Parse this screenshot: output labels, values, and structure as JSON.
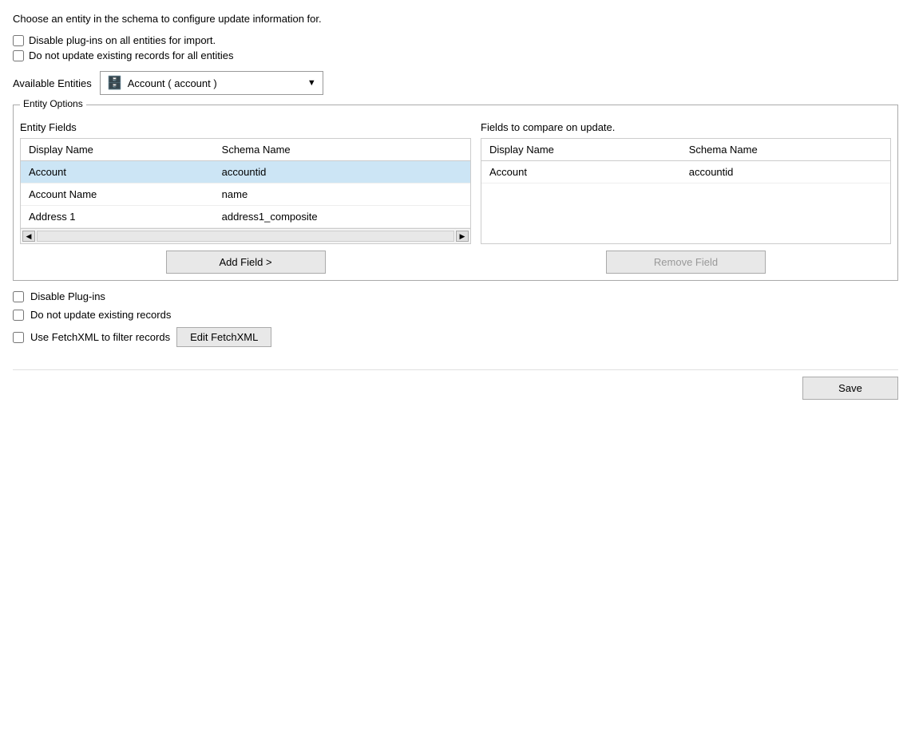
{
  "intro": {
    "text": "Choose an entity in the schema to configure update information for."
  },
  "global_options": {
    "disable_plugins_label": "Disable plug-ins on all entities for import.",
    "no_update_all_label": "Do not update existing records for all entities"
  },
  "entities_section": {
    "label": "Available Entities",
    "dropdown_value": "Account  ( account )",
    "db_icon": "🗄️"
  },
  "entity_options": {
    "legend": "Entity Options",
    "left_panel_label": "Entity Fields",
    "right_panel_label": "Fields to compare on update.",
    "left_columns": [
      "Display Name",
      "Schema Name"
    ],
    "left_rows": [
      {
        "display_name": "Account",
        "schema_name": "accountid",
        "selected": true
      },
      {
        "display_name": "Account Name",
        "schema_name": "name",
        "selected": false
      },
      {
        "display_name": "Address 1",
        "schema_name": "address1_composite",
        "selected": false
      }
    ],
    "right_columns": [
      "Display Name",
      "Schema Name"
    ],
    "right_rows": [
      {
        "display_name": "Account",
        "schema_name": "accountid"
      }
    ],
    "add_field_label": "Add Field >",
    "remove_field_label": "Remove Field"
  },
  "bottom_options": {
    "disable_plugins_label": "Disable Plug-ins",
    "no_update_label": "Do not update existing records",
    "fetchxml_label": "Use FetchXML to filter records",
    "edit_fetchxml_label": "Edit FetchXML"
  },
  "footer": {
    "save_label": "Save"
  }
}
